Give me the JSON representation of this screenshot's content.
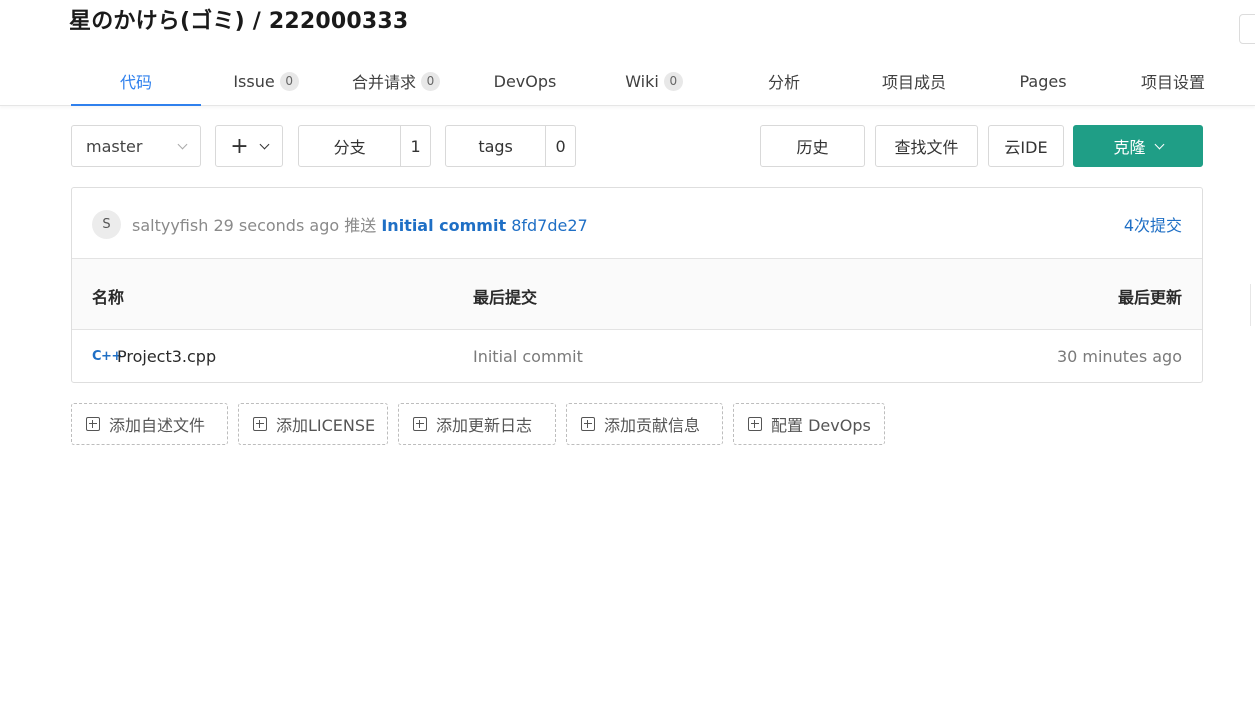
{
  "repo_title": "星のかけら(ゴミ) / 222000333",
  "tabs": [
    {
      "label": "代码",
      "badge": null,
      "active": true
    },
    {
      "label": "Issue",
      "badge": "0"
    },
    {
      "label": "合并请求",
      "badge": "0"
    },
    {
      "label": "DevOps",
      "badge": null
    },
    {
      "label": "Wiki",
      "badge": "0"
    },
    {
      "label": "分析",
      "badge": null
    },
    {
      "label": "项目成员",
      "badge": null
    },
    {
      "label": "Pages",
      "badge": null
    },
    {
      "label": "项目设置",
      "badge": null
    }
  ],
  "toolbar": {
    "branch": "master",
    "add": "+",
    "branches_label": "分支",
    "branches_count": "1",
    "tags_label": "tags",
    "tags_count": "0",
    "history": "历史",
    "find_file": "查找文件",
    "cloud_ide": "云IDE",
    "clone": "克隆"
  },
  "commit": {
    "avatar": "S",
    "author": "saltyyfish",
    "time": "29 seconds ago",
    "action": "推送",
    "message": "Initial commit",
    "hash": "8fd7de27",
    "count": "4次提交"
  },
  "table": {
    "headers": [
      "名称",
      "最后提交",
      "最后更新"
    ],
    "rows": [
      {
        "icon": "C++",
        "name": "Project3.cpp",
        "commit": "Initial commit",
        "updated": "30 minutes ago"
      }
    ]
  },
  "quick_actions": [
    "添加自述文件",
    "添加LICENSE",
    "添加更新日志",
    "添加贡献信息",
    "配置 DevOps"
  ],
  "colors": {
    "accent": "#2f80ed",
    "primary": "#1f9e86",
    "link": "#1f6fc5"
  }
}
